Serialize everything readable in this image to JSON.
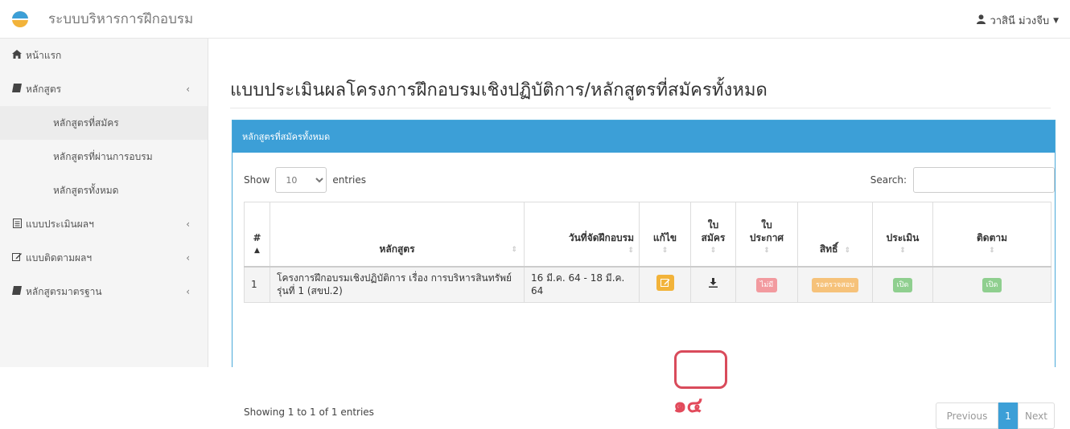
{
  "app": {
    "title": "ระบบบริหารการฝึกอบรม",
    "user": "วาสินี ม่วงจีบ"
  },
  "sidebar": {
    "items": [
      {
        "label": "หน้าแรก",
        "icon": "home-icon"
      },
      {
        "label": "หลักสูตร",
        "icon": "book-icon"
      },
      {
        "label": "หลักสูตรที่สมัคร"
      },
      {
        "label": "หลักสูตรที่ผ่านการอบรม"
      },
      {
        "label": "หลักสูตรทั้งหมด"
      },
      {
        "label": "แบบประเมินผลฯ",
        "icon": "file-icon"
      },
      {
        "label": "แบบติดตามผลฯ",
        "icon": "edit-icon"
      },
      {
        "label": "หลักสูตรมาตรฐาน",
        "icon": "book-icon"
      }
    ]
  },
  "page": {
    "title": "แบบประเมินผลโครงการฝึกอบรมเชิงปฏิบัติการ/หลักสูตรที่สมัครทั้งหมด"
  },
  "panel": {
    "title": "หลักสูตรที่สมัครทั้งหมด",
    "show_label": "Show",
    "entries_value": "10",
    "entries_label": "entries",
    "search_label": "Search:"
  },
  "table": {
    "headers": {
      "num": "#",
      "course": "หลักสูตร",
      "date": "วันที่จัดฝึกอบรม",
      "edit": "แก้ไข",
      "app_line1": "ใบ",
      "app_line2": "สมัคร",
      "ann_line1": "ใบ",
      "ann_line2": "ประกาศ",
      "rights": "สิทธิ์",
      "evaluate": "ประเมิน",
      "follow": "ติดตาม"
    },
    "rows": [
      {
        "num": "1",
        "course": "โครงการฝึกอบรมเชิงปฏิบัติการ เรื่อง การบริหารสินทรัพย์ รุ่นที่ 1 (สขป.2)",
        "date": "16 มี.ค. 64 - 18 มี.ค. 64",
        "announce": "ไม่มี",
        "rights": "รอตรวจสอบ",
        "evaluate": "เปิด",
        "follow": "เปิด"
      }
    ]
  },
  "annotation": "๑๔",
  "footer": {
    "info": "Showing 1 to 1 of 1 entries",
    "previous": "Previous",
    "page": "1",
    "next": "Next"
  },
  "colors": {
    "primary": "#3c9fd7",
    "edit_button": "#f2b33a",
    "highlight": "#d94b5b",
    "badge_red": "#f29a9f",
    "badge_orange": "#f6c27a",
    "badge_green": "#8fcf8f"
  }
}
